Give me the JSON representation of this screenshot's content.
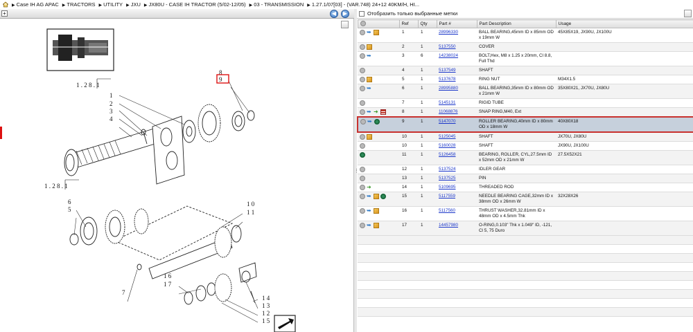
{
  "breadcrumb": {
    "items": [
      "Case IH AG APAC",
      "TRACTORS",
      "UTILITY",
      "JXU",
      "JX80U - CASE IH TRACTOR (5/02-12/05)",
      "03 - TRANSMISSION",
      "1.27.1/07[03] - (VAR.748) 24+12 40KM/H, HI..."
    ]
  },
  "filter": {
    "label": "Отобразить только выбранные метки"
  },
  "table": {
    "headers": [
      "Ref",
      "Qty",
      "Part #",
      "Part Description",
      "Usage"
    ],
    "rows": [
      {
        "icons": [
          "info-icon",
          "arrow-icon",
          "package-icon"
        ],
        "ref": "1",
        "qty": "1",
        "part": "28996330",
        "desc": "BALL BEARING,45mm ID x 85mm OD x 19mm W",
        "usage": "45X85X19, JX90U, JX100U"
      },
      {
        "icons": [
          "info-icon",
          "package-icon"
        ],
        "ref": "2",
        "qty": "1",
        "part": "5137550",
        "desc": "COVER",
        "usage": ""
      },
      {
        "icons": [
          "info-icon",
          "arrow-icon"
        ],
        "ref": "3",
        "qty": "6",
        "part": "14238024",
        "desc": "BOLT,Hex, M8 x 1.25 x 20mm, Cl 8.8, Full Thd",
        "usage": ""
      },
      {
        "icons": [
          "info-icon"
        ],
        "ref": "4",
        "qty": "1",
        "part": "5137549",
        "desc": "SHAFT",
        "usage": ""
      },
      {
        "icons": [
          "info-icon",
          "package-icon"
        ],
        "ref": "5",
        "qty": "1",
        "part": "5137678",
        "desc": "RING NUT",
        "usage": "M34X1.5"
      },
      {
        "icons": [
          "info-icon",
          "arrow-icon"
        ],
        "ref": "6",
        "qty": "1",
        "part": "28995880",
        "desc": "BALL BEARING,35mm ID x 80mm OD x 21mm W",
        "usage": "35X80X21, JX70U, JX80U"
      },
      {
        "icons": [
          "info-icon"
        ],
        "ref": "7",
        "qty": "1",
        "part": "5145131",
        "desc": "RIGID TUBE",
        "usage": ""
      },
      {
        "icons": [
          "info-icon",
          "arrow-icon",
          "green-arrow-icon",
          "book-icon"
        ],
        "ref": "8",
        "qty": "1",
        "part": "11068876",
        "desc": "SNAP RING,M40, Ext",
        "usage": ""
      },
      {
        "icons": [
          "info-icon",
          "arrow-icon",
          "alternate-icon"
        ],
        "ref": "9",
        "qty": "1",
        "part": "5147070",
        "desc": "ROLLER BEARING,40mm ID x 80mm OD x 18mm W",
        "usage": "40X80X18"
      },
      {
        "icons": [
          "info-icon",
          "package-icon"
        ],
        "ref": "10",
        "qty": "1",
        "part": "5125045",
        "desc": "SHAFT",
        "usage": "JX70U, JX80U"
      },
      {
        "icons": [
          "info-icon"
        ],
        "ref": "10",
        "qty": "1",
        "part": "5160028",
        "desc": "SHAFT",
        "usage": "JX90U, JX100U"
      },
      {
        "icons": [
          "alternate-icon"
        ],
        "ref": "11",
        "qty": "1",
        "part": "5126458",
        "desc": "BEARING, ROLLER, CYL,27.5mm ID x 52mm OD x 21mm W",
        "usage": "27.5X52X21"
      },
      {
        "icons": [
          "info-icon"
        ],
        "ref": "12",
        "qty": "1",
        "part": "5137524",
        "desc": "IDLER GEAR",
        "usage": ""
      },
      {
        "icons": [
          "info-icon"
        ],
        "ref": "13",
        "qty": "1",
        "part": "5137525",
        "desc": "PIN",
        "usage": ""
      },
      {
        "icons": [
          "info-icon",
          "green-arrow-icon"
        ],
        "ref": "14",
        "qty": "1",
        "part": "5109695",
        "desc": "THREADED ROD",
        "usage": ""
      },
      {
        "icons": [
          "info-icon",
          "arrow-icon",
          "package-icon",
          "alternate-icon"
        ],
        "ref": "15",
        "qty": "1",
        "part": "5117559",
        "desc": "NEEDLE BEARING CAGE,32mm ID x 38mm OD x 26mm W",
        "usage": "32X28X26"
      },
      {
        "icons": [
          "info-icon",
          "arrow-icon",
          "package-icon"
        ],
        "ref": "16",
        "qty": "1",
        "part": "5117560",
        "desc": "THRUST WASHER,32.81mm ID x 48mm OD x 4.5mm Thk",
        "usage": ""
      },
      {
        "icons": [
          "info-icon",
          "arrow-icon",
          "package-icon"
        ],
        "ref": "17",
        "qty": "1",
        "part": "14457980",
        "desc": "O-RING,0.103\" Thk x 1.049\" ID, -121, Cl 5, 75 Duro",
        "usage": ""
      }
    ],
    "selected_ref": "9"
  },
  "drawing": {
    "callouts": [
      "1 . 2 8 . 1",
      "1",
      "2",
      "3",
      "4",
      "8",
      "9",
      "1 . 2 8 . 1",
      "6",
      "5",
      "1 0",
      "1 1",
      "7",
      "1 6",
      "1 7",
      "1 4",
      "1 3",
      "1 2",
      "1 5"
    ]
  }
}
